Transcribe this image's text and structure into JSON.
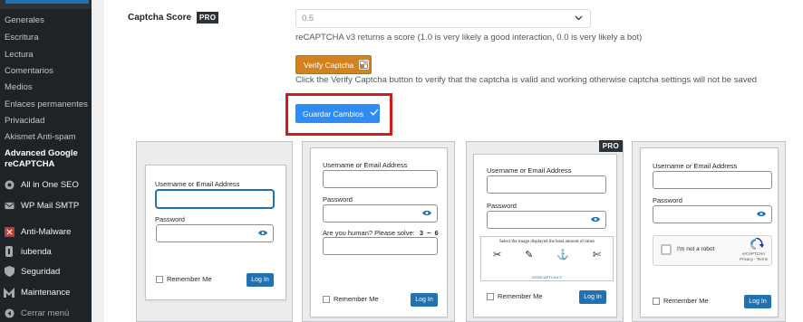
{
  "sidebar": {
    "items": [
      {
        "label": "Generales"
      },
      {
        "label": "Escritura"
      },
      {
        "label": "Lectura"
      },
      {
        "label": "Comentarios"
      },
      {
        "label": "Medios"
      },
      {
        "label": "Enlaces permanentes"
      },
      {
        "label": "Privacidad"
      },
      {
        "label": "Akismet Anti-spam"
      }
    ],
    "current": {
      "line1": "Advanced Google",
      "line2": "reCAPTCHA"
    },
    "menus": [
      {
        "label": "All in One SEO",
        "icon": "aioseo-icon"
      },
      {
        "label": "WP Mail SMTP",
        "icon": "wp-mail-smtp-icon"
      },
      {
        "label": "Anti-Malware",
        "icon": "anti-malware-icon"
      },
      {
        "label": "iubenda",
        "icon": "iubenda-icon"
      },
      {
        "label": "Seguridad",
        "icon": "shield-icon"
      },
      {
        "label": "Maintenance",
        "icon": "maintenance-icon"
      }
    ],
    "collapse": "Cerrar menú"
  },
  "settings": {
    "score_label": "Captcha Score",
    "pro": "PRO",
    "score_value": "0.5",
    "score_help": "reCAPTCHA v3 returns a score (1.0 is very likely a good interaction, 0.0 is very likely a bot)",
    "verify_label": "Verify Captcha",
    "verify_help": "Click the Verify Captcha button to verify that the captcha is valid and working otherwise captcha settings will not be saved",
    "save_label": "Guardar Cambios"
  },
  "previews": {
    "username_label": "Username or Email Address",
    "password_label": "Password",
    "remember_label": "Remember Me",
    "login_label": "Log In",
    "math_label": "Are you human? Please solve:",
    "math_expr": "3 − 6",
    "pro": "PRO",
    "image_captcha_title": "Select the image displayed the least amount of times",
    "image_captcha_brand": "IGONCAPTCHA ©",
    "recaptcha_label": "I'm not a robot",
    "recaptcha_brand": "reCAPTCHA",
    "recaptcha_terms": "Privacy - Terms"
  },
  "colors": {
    "sidebar_bg": "#1d2327",
    "verify_orange": "#d3831e",
    "save_blue": "#2f8cf2",
    "highlight_red": "#d41b1b",
    "wp_blue": "#2271b1"
  }
}
